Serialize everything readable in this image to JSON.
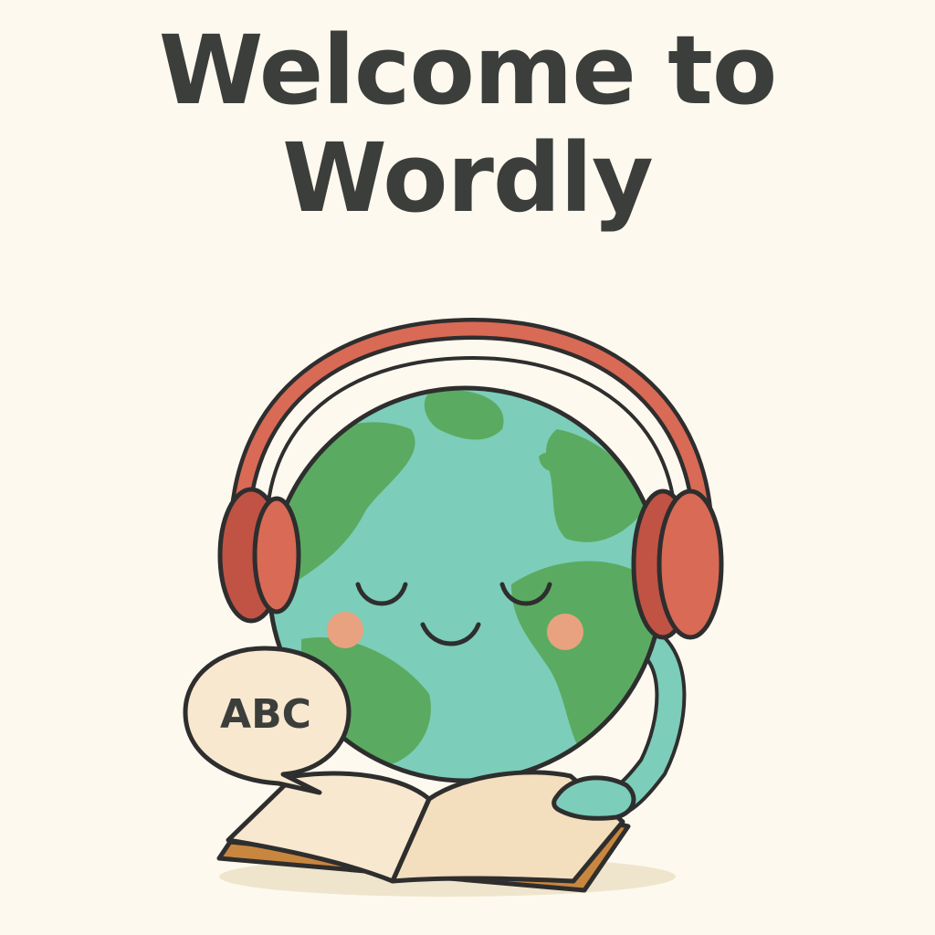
{
  "welcome": {
    "title_line1": "Welcome to",
    "title_line2": "Wordly"
  },
  "mascot": {
    "speech_bubble_text": "ABC",
    "icons": [
      "globe-mascot-icon",
      "headphones-icon",
      "speech-bubble-icon",
      "open-book-icon"
    ]
  },
  "colors": {
    "background": "#fdf9ee",
    "title_text": "#3b3e3b",
    "ocean": "#7ccdb9",
    "land": "#5aab61",
    "headphones": "#d96a55",
    "cheeks": "#e8a27f",
    "book_page": "#f7e8cf",
    "book_cover": "#c9863f",
    "outline": "#2e2e2e"
  }
}
